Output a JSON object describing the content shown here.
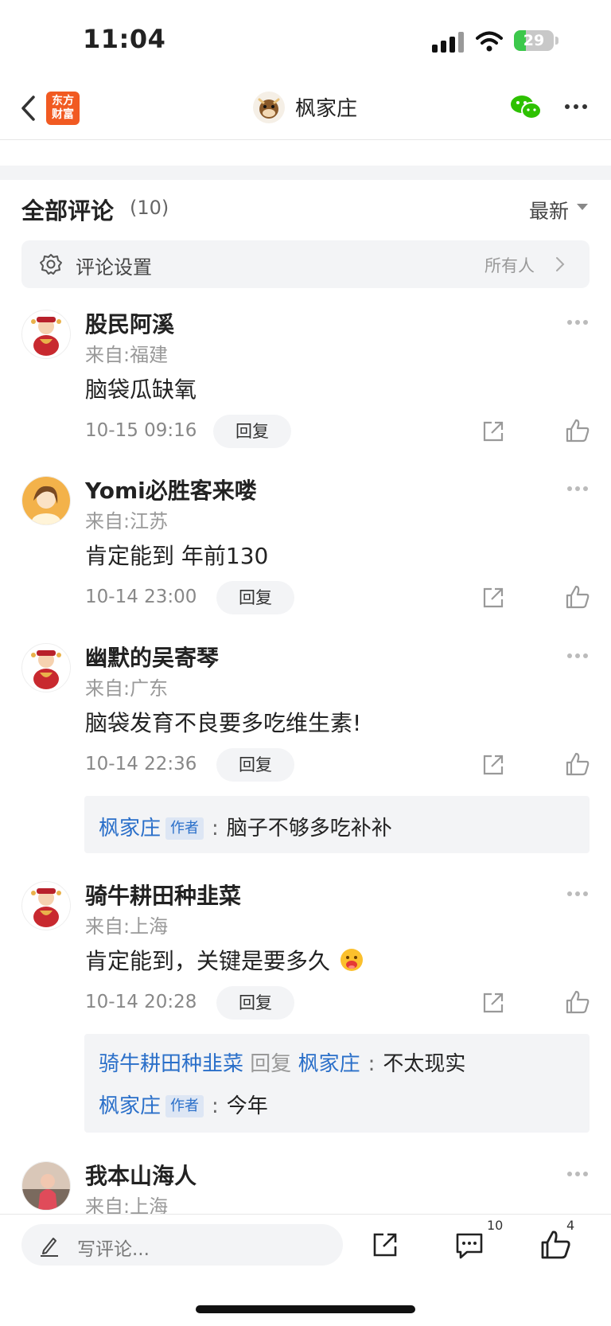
{
  "status_bar": {
    "time": "11:04",
    "battery": "29",
    "battery_level_percent": 29
  },
  "nav": {
    "logo_line1": "东方",
    "logo_line2": "财富",
    "title": "枫家庄",
    "icons": [
      "back-icon",
      "wechat-icon",
      "more-icon"
    ]
  },
  "header": {
    "title": "全部评论",
    "count": "(10)",
    "sort": "最新"
  },
  "settings": {
    "label": "评论设置",
    "value": "所有人"
  },
  "comments": [
    {
      "user": "股民阿溪",
      "region": "来自:福建",
      "text": "脑袋瓜缺氧",
      "time": "10-15 09:16",
      "reply": "回复"
    },
    {
      "user": "Yomi必胜客来喽",
      "region": "来自:江苏",
      "text": "肯定能到 年前130",
      "time": "10-14 23:00",
      "reply": "回复"
    },
    {
      "user": "幽默的吴寄琴",
      "region": "来自:广东",
      "text": "脑袋发育不良要多吃维生素!",
      "time": "10-14 22:36",
      "reply": "回复"
    },
    {
      "user": "骑牛耕田种韭菜",
      "region": "来自:上海",
      "text": "肯定能到，关键是要多久",
      "time": "10-14 20:28",
      "reply": "回复"
    },
    {
      "user": "我本山海人",
      "region": "来自:上海"
    }
  ],
  "replies": {
    "c3": {
      "author": "枫家庄",
      "tag": "作者",
      "sep": ":",
      "text": "脑子不够多吃补补"
    },
    "c4a": {
      "from": "骑牛耕田种韭菜",
      "verb": "回复",
      "to": "枫家庄",
      "sep": ":",
      "text": "不太现实"
    },
    "c4b": {
      "author": "枫家庄",
      "tag": "作者",
      "sep": ":",
      "text": "今年"
    }
  },
  "bottom_bar": {
    "placeholder": "写评论...",
    "comment_count": "10",
    "like_count": "4"
  },
  "colors": {
    "accent_blue": "#2a6fc9",
    "brand_orange": "#f15a22",
    "wechat_green": "#2dc100"
  }
}
